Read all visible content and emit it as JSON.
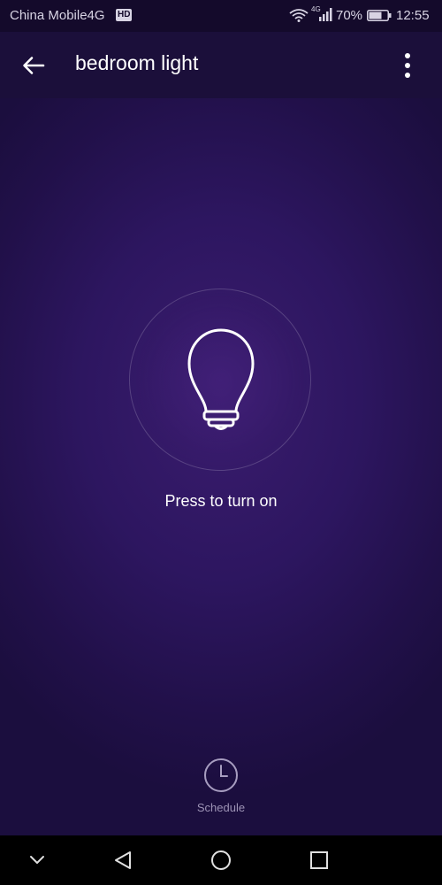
{
  "status_bar": {
    "carrier": "China Mobile4G",
    "hd_badge": "HD",
    "network_type": "4G",
    "battery_percent": "70%",
    "time": "12:55",
    "battery_level": 0.7
  },
  "app_bar": {
    "title": "bedroom light",
    "back_icon": "arrow-left-icon",
    "more_icon": "more-vertical-icon"
  },
  "power": {
    "icon": "light-bulb-icon",
    "hint": "Press to turn on"
  },
  "schedule": {
    "icon": "clock-icon",
    "label": "Schedule"
  },
  "nav_bar": {
    "items": [
      "chevron-down-icon",
      "back-triangle-icon",
      "home-circle-icon",
      "recents-square-icon"
    ]
  },
  "colors": {
    "background": "#2d1660",
    "app_bar": "#1b0f3a",
    "status_bar": "#140a2b",
    "text_primary": "#ffffff",
    "text_secondary": "#9d93b5"
  }
}
